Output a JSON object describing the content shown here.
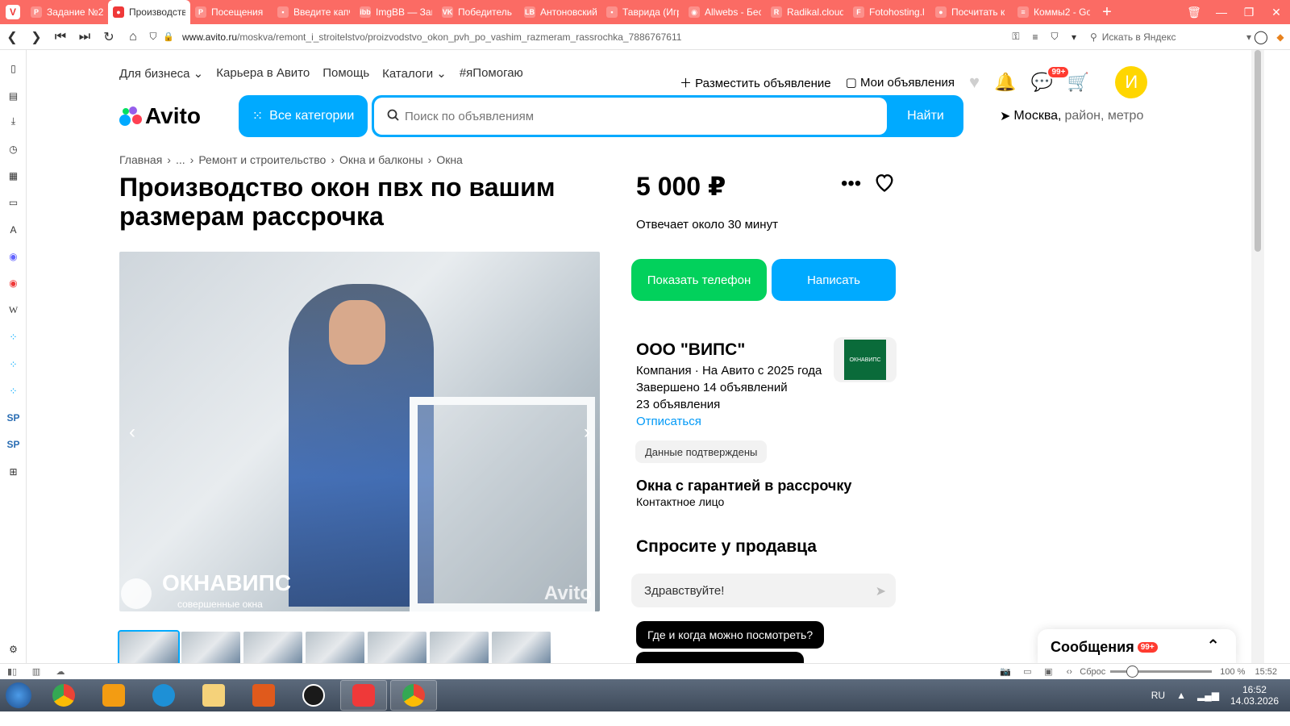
{
  "tabs": [
    {
      "label": "Задание №2",
      "color": "#fb6b64",
      "glyph": "P"
    },
    {
      "label": "Производство",
      "color": "#ef3939",
      "glyph": "●",
      "active": true
    },
    {
      "label": "Посещения",
      "color": "#fb6b64",
      "glyph": "P"
    },
    {
      "label": "Введите капч",
      "color": "#fb6b64",
      "glyph": "▪"
    },
    {
      "label": "ImgBB — Загр",
      "color": "#2a6db3",
      "glyph": "ibb"
    },
    {
      "label": "Победитель",
      "color": "#0077ff",
      "glyph": "VK"
    },
    {
      "label": "Антоновский",
      "color": "#444",
      "glyph": "LB"
    },
    {
      "label": "Таврида (Игр",
      "color": "#35a853",
      "glyph": "▪"
    },
    {
      "label": "Allwebs - Бес",
      "color": "#3a7bd5",
      "glyph": "◉"
    },
    {
      "label": "Radikal.cloud",
      "color": "#222",
      "glyph": "R"
    },
    {
      "label": "Fotohosting.l",
      "color": "#f4b400",
      "glyph": "F"
    },
    {
      "label": "Посчитать к",
      "color": "#1a2adb",
      "glyph": "●"
    },
    {
      "label": "Коммы2 - Go",
      "color": "#4285f4",
      "glyph": "≡"
    }
  ],
  "address": {
    "url_host": "www.avito.ru",
    "url_path": "/moskva/remont_i_stroitelstvo/proizvodstvo_okon_pvh_po_vashim_razmeram_rassrochka_7886767611",
    "yandex_placeholder": "Искать в Яндекс"
  },
  "topnav": {
    "items": [
      "Для бизнеса ⌄",
      "Карьера в Авито",
      "Помощь",
      "Каталоги ⌄",
      "#яПомогаю"
    ],
    "post_ad": "Разместить объявление",
    "my_ads": "Мои объявления",
    "messages_badge": "99+",
    "avatar_letter": "И"
  },
  "header": {
    "logo_text": "Avito",
    "categories_button": "Все категории",
    "search_placeholder": "Поиск по объявлениям",
    "search_button": "Найти",
    "location_main": "Москва,",
    "location_rest": " район, метро"
  },
  "breadcrumb": [
    "Главная",
    "...",
    "Ремонт и строительство",
    "Окна и балконы",
    "Окна"
  ],
  "listing": {
    "title": "Производство окон пвх по вашим размерам рассрочка",
    "price": "5 000 ₽",
    "reply_time": "Отвечает около 30 минут",
    "show_phone": "Показать телефон",
    "write": "Написать"
  },
  "gallery": {
    "watermark_title": "ОКНАВИПС",
    "watermark_sub": "совершенные окна",
    "watermark_avito": "Avito",
    "thumb_count": 7
  },
  "seller": {
    "name": "ООО \"ВИПС\"",
    "logo_text": "ОКНАВИПС",
    "type_since": "Компания · На Авито с 2025 года",
    "completed": "Завершено 14 объявлений",
    "ads_count": "23 объявления",
    "unsubscribe": "Отписаться",
    "verified": "Данные подтверждены",
    "shop_name": "Окна с гарантией в рассрочку",
    "contact": "Контактное лицо"
  },
  "ask": {
    "title": "Спросите у продавца",
    "input_value": "Здравствуйте!",
    "question1": "Где и когда можно посмотреть?"
  },
  "messages_widget": {
    "label": "Сообщения",
    "badge": "99+"
  },
  "statusbar": {
    "reset": "Сброс",
    "zoom": "100 %",
    "time": "15:52"
  },
  "taskbar": {
    "lang": "RU",
    "time": "16:52",
    "date": "14.03.2026"
  },
  "colors": {
    "accent": "#00aaff",
    "green": "#02d15c",
    "tabbar": "#fb6b64"
  }
}
